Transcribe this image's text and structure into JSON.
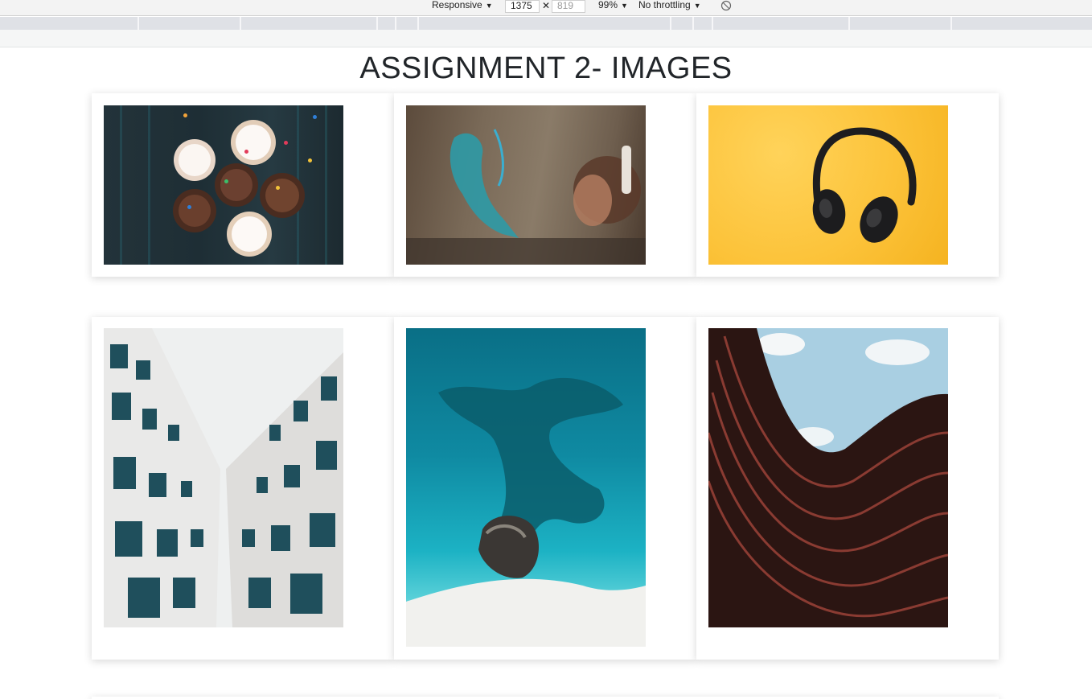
{
  "devtools": {
    "device_mode": "Responsive",
    "width": "1375",
    "height_placeholder": "819",
    "zoom": "99%",
    "throttling": "No throttling"
  },
  "page": {
    "title": "ASSIGNMENT 2- IMAGES"
  },
  "images": [
    {
      "subject": "cupcakes"
    },
    {
      "subject": "graffiti-wall"
    },
    {
      "subject": "headphones"
    },
    {
      "subject": "building-looking-up"
    },
    {
      "subject": "aerial-coast"
    },
    {
      "subject": "curved-building"
    }
  ],
  "colors": {
    "title_text": "#212529",
    "headphones_bg": "#fcc33a",
    "sea": "#0f8aa2"
  }
}
